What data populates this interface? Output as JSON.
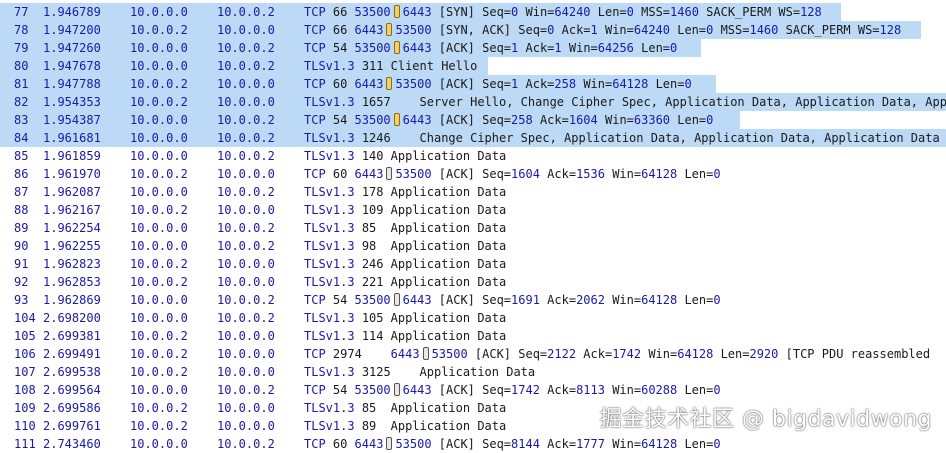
{
  "packets": [
    {
      "no": "77",
      "time": "1.946789",
      "src": "10.0.0.0",
      "dst": "10.0.0.2",
      "proto": "TCP",
      "len": "66",
      "selected": true,
      "hl": 841,
      "parts": [
        [
          "num",
          "53500"
        ],
        [
          "br",
          ""
        ],
        [
          "num",
          "6443"
        ],
        [
          "txt",
          " [SYN] Seq="
        ],
        [
          "num",
          "0"
        ],
        [
          "txt",
          " Win="
        ],
        [
          "num",
          "64240"
        ],
        [
          "txt",
          " Len="
        ],
        [
          "num",
          "0"
        ],
        [
          "txt",
          " MSS="
        ],
        [
          "num",
          "1460"
        ],
        [
          "txt",
          " SACK_PERM WS="
        ],
        [
          "num",
          "128"
        ]
      ]
    },
    {
      "no": "78",
      "time": "1.947200",
      "src": "10.0.0.2",
      "dst": "10.0.0.0",
      "proto": "TCP",
      "len": "66",
      "selected": true,
      "hl": 921,
      "parts": [
        [
          "num",
          "6443"
        ],
        [
          "br",
          ""
        ],
        [
          "num",
          "53500"
        ],
        [
          "txt",
          " [SYN, ACK] Seq="
        ],
        [
          "num",
          "0"
        ],
        [
          "txt",
          " Ack="
        ],
        [
          "num",
          "1"
        ],
        [
          "txt",
          " Win="
        ],
        [
          "num",
          "64240"
        ],
        [
          "txt",
          " Len="
        ],
        [
          "num",
          "0"
        ],
        [
          "txt",
          " MSS="
        ],
        [
          "num",
          "1460"
        ],
        [
          "txt",
          " SACK_PERM WS="
        ],
        [
          "num",
          "128"
        ]
      ]
    },
    {
      "no": "79",
      "time": "1.947260",
      "src": "10.0.0.0",
      "dst": "10.0.0.2",
      "proto": "TCP",
      "len": "54",
      "selected": true,
      "hl": 701,
      "parts": [
        [
          "num",
          "53500"
        ],
        [
          "br",
          ""
        ],
        [
          "num",
          "6443"
        ],
        [
          "txt",
          " [ACK] Seq="
        ],
        [
          "num",
          "1"
        ],
        [
          "txt",
          " Ack="
        ],
        [
          "num",
          "1"
        ],
        [
          "txt",
          " Win="
        ],
        [
          "num",
          "64256"
        ],
        [
          "txt",
          " Len="
        ],
        [
          "num",
          "0"
        ]
      ]
    },
    {
      "no": "80",
      "time": "1.947678",
      "src": "10.0.0.0",
      "dst": "10.0.0.2",
      "proto": "TLSv1.3",
      "len": "311",
      "selected": true,
      "hl": 488,
      "parts": [
        [
          "txt",
          "Client Hello"
        ]
      ]
    },
    {
      "no": "81",
      "time": "1.947788",
      "src": "10.0.0.2",
      "dst": "10.0.0.0",
      "proto": "TCP",
      "len": "60",
      "selected": true,
      "hl": 716,
      "parts": [
        [
          "num",
          "6443"
        ],
        [
          "br",
          ""
        ],
        [
          "num",
          "53500"
        ],
        [
          "txt",
          " [ACK] Seq="
        ],
        [
          "num",
          "1"
        ],
        [
          "txt",
          " Ack="
        ],
        [
          "num",
          "258"
        ],
        [
          "txt",
          " Win="
        ],
        [
          "num",
          "64128"
        ],
        [
          "txt",
          " Len="
        ],
        [
          "num",
          "0"
        ]
      ]
    },
    {
      "no": "82",
      "time": "1.954353",
      "src": "10.0.0.2",
      "dst": "10.0.0.0",
      "proto": "TLSv1.3",
      "len": "1657",
      "selected": true,
      "hl": 946,
      "parts": [
        [
          "txt",
          "   Server Hello, Change Cipher Spec, Application Data, Application Data, App"
        ]
      ]
    },
    {
      "no": "83",
      "time": "1.954387",
      "src": "10.0.0.0",
      "dst": "10.0.0.2",
      "proto": "TCP",
      "len": "54",
      "selected": true,
      "hl": 740,
      "parts": [
        [
          "num",
          "53500"
        ],
        [
          "br",
          ""
        ],
        [
          "num",
          "6443"
        ],
        [
          "txt",
          " [ACK] Seq="
        ],
        [
          "num",
          "258"
        ],
        [
          "txt",
          " Ack="
        ],
        [
          "num",
          "1604"
        ],
        [
          "txt",
          " Win="
        ],
        [
          "num",
          "63360"
        ],
        [
          "txt",
          " Len="
        ],
        [
          "num",
          "0"
        ]
      ]
    },
    {
      "no": "84",
      "time": "1.961681",
      "src": "10.0.0.0",
      "dst": "10.0.0.2",
      "proto": "TLSv1.3",
      "len": "1246",
      "selected": true,
      "hl": 946,
      "parts": [
        [
          "txt",
          "   Change Cipher Spec, Application Data, Application Data, Application Data"
        ]
      ]
    },
    {
      "no": "85",
      "time": "1.961859",
      "src": "10.0.0.0",
      "dst": "10.0.0.2",
      "proto": "TLSv1.3",
      "len": "140",
      "selected": false,
      "parts": [
        [
          "txt",
          "Application Data"
        ]
      ]
    },
    {
      "no": "86",
      "time": "1.961970",
      "src": "10.0.0.2",
      "dst": "10.0.0.0",
      "proto": "TCP",
      "len": "60",
      "selected": false,
      "parts": [
        [
          "num",
          "6443"
        ],
        [
          "br",
          ""
        ],
        [
          "num",
          "53500"
        ],
        [
          "txt",
          " [ACK] Seq="
        ],
        [
          "num",
          "1604"
        ],
        [
          "txt",
          " Ack="
        ],
        [
          "num",
          "1536"
        ],
        [
          "txt",
          " Win="
        ],
        [
          "num",
          "64128"
        ],
        [
          "txt",
          " Len="
        ],
        [
          "num",
          "0"
        ]
      ]
    },
    {
      "no": "87",
      "time": "1.962087",
      "src": "10.0.0.0",
      "dst": "10.0.0.2",
      "proto": "TLSv1.3",
      "len": "178",
      "selected": false,
      "parts": [
        [
          "txt",
          "Application Data"
        ]
      ]
    },
    {
      "no": "88",
      "time": "1.962167",
      "src": "10.0.0.2",
      "dst": "10.0.0.0",
      "proto": "TLSv1.3",
      "len": "109",
      "selected": false,
      "parts": [
        [
          "txt",
          "Application Data"
        ]
      ]
    },
    {
      "no": "89",
      "time": "1.962254",
      "src": "10.0.0.0",
      "dst": "10.0.0.2",
      "proto": "TLSv1.3",
      "len": "85",
      "selected": false,
      "parts": [
        [
          "txt",
          " Application Data"
        ]
      ]
    },
    {
      "no": "90",
      "time": "1.962255",
      "src": "10.0.0.0",
      "dst": "10.0.0.2",
      "proto": "TLSv1.3",
      "len": "98",
      "selected": false,
      "parts": [
        [
          "txt",
          " Application Data"
        ]
      ]
    },
    {
      "no": "91",
      "time": "1.962823",
      "src": "10.0.0.2",
      "dst": "10.0.0.0",
      "proto": "TLSv1.3",
      "len": "246",
      "selected": false,
      "parts": [
        [
          "txt",
          "Application Data"
        ]
      ]
    },
    {
      "no": "92",
      "time": "1.962853",
      "src": "10.0.0.2",
      "dst": "10.0.0.0",
      "proto": "TLSv1.3",
      "len": "221",
      "selected": false,
      "parts": [
        [
          "txt",
          "Application Data"
        ]
      ]
    },
    {
      "no": "93",
      "time": "1.962869",
      "src": "10.0.0.0",
      "dst": "10.0.0.2",
      "proto": "TCP",
      "len": "54",
      "selected": false,
      "parts": [
        [
          "num",
          "53500"
        ],
        [
          "br",
          ""
        ],
        [
          "num",
          "6443"
        ],
        [
          "txt",
          " [ACK] Seq="
        ],
        [
          "num",
          "1691"
        ],
        [
          "txt",
          " Ack="
        ],
        [
          "num",
          "2062"
        ],
        [
          "txt",
          " Win="
        ],
        [
          "num",
          "64128"
        ],
        [
          "txt",
          " Len="
        ],
        [
          "num",
          "0"
        ]
      ]
    },
    {
      "no": "104",
      "time": "2.698200",
      "src": "10.0.0.0",
      "dst": "10.0.0.2",
      "proto": "TLSv1.3",
      "len": "105",
      "selected": false,
      "parts": [
        [
          "txt",
          "Application Data"
        ]
      ]
    },
    {
      "no": "105",
      "time": "2.699381",
      "src": "10.0.0.2",
      "dst": "10.0.0.0",
      "proto": "TLSv1.3",
      "len": "114",
      "selected": false,
      "parts": [
        [
          "txt",
          "Application Data"
        ]
      ]
    },
    {
      "no": "106",
      "time": "2.699491",
      "src": "10.0.0.2",
      "dst": "10.0.0.0",
      "proto": "TCP",
      "len": "2974",
      "selected": false,
      "parts": [
        [
          "txt",
          "   "
        ],
        [
          "num",
          "6443"
        ],
        [
          "br",
          ""
        ],
        [
          "num",
          "53500"
        ],
        [
          "txt",
          " [ACK] Seq="
        ],
        [
          "num",
          "2122"
        ],
        [
          "txt",
          " Ack="
        ],
        [
          "num",
          "1742"
        ],
        [
          "txt",
          " Win="
        ],
        [
          "num",
          "64128"
        ],
        [
          "txt",
          " Len="
        ],
        [
          "num",
          "2920"
        ],
        [
          "txt",
          " [TCP PDU reassembled"
        ]
      ]
    },
    {
      "no": "107",
      "time": "2.699538",
      "src": "10.0.0.2",
      "dst": "10.0.0.0",
      "proto": "TLSv1.3",
      "len": "3125",
      "selected": false,
      "parts": [
        [
          "txt",
          "   Application Data"
        ]
      ]
    },
    {
      "no": "108",
      "time": "2.699564",
      "src": "10.0.0.0",
      "dst": "10.0.0.2",
      "proto": "TCP",
      "len": "54",
      "selected": false,
      "parts": [
        [
          "num",
          "53500"
        ],
        [
          "br",
          ""
        ],
        [
          "num",
          "6443"
        ],
        [
          "txt",
          " [ACK] Seq="
        ],
        [
          "num",
          "1742"
        ],
        [
          "txt",
          " Ack="
        ],
        [
          "num",
          "8113"
        ],
        [
          "txt",
          " Win="
        ],
        [
          "num",
          "60288"
        ],
        [
          "txt",
          " Len="
        ],
        [
          "num",
          "0"
        ]
      ]
    },
    {
      "no": "109",
      "time": "2.699586",
      "src": "10.0.0.2",
      "dst": "10.0.0.0",
      "proto": "TLSv1.3",
      "len": "85",
      "selected": false,
      "parts": [
        [
          "txt",
          " Application Data"
        ]
      ]
    },
    {
      "no": "110",
      "time": "2.699761",
      "src": "10.0.0.2",
      "dst": "10.0.0.0",
      "proto": "TLSv1.3",
      "len": "89",
      "selected": false,
      "parts": [
        [
          "txt",
          " Application Data"
        ]
      ]
    },
    {
      "no": "111",
      "time": "2.743460",
      "src": "10.0.0.0",
      "dst": "10.0.0.2",
      "proto": "TCP",
      "len": "60",
      "selected": false,
      "parts": [
        [
          "num",
          "6443"
        ],
        [
          "br",
          ""
        ],
        [
          "num",
          "53500"
        ],
        [
          "txt",
          " [ACK] Seq="
        ],
        [
          "num",
          "8144"
        ],
        [
          "txt",
          " Ack="
        ],
        [
          "num",
          "1777"
        ],
        [
          "txt",
          " Win="
        ],
        [
          "num",
          "64128"
        ],
        [
          "txt",
          " Len="
        ],
        [
          "num",
          "0"
        ]
      ]
    }
  ],
  "watermark": "掘金技术社区 @ bigdavidwong",
  "colors": {
    "selection": "#bcd9f5",
    "packet_text": "#1a1aa6",
    "info_text": "#1a1a1a"
  }
}
